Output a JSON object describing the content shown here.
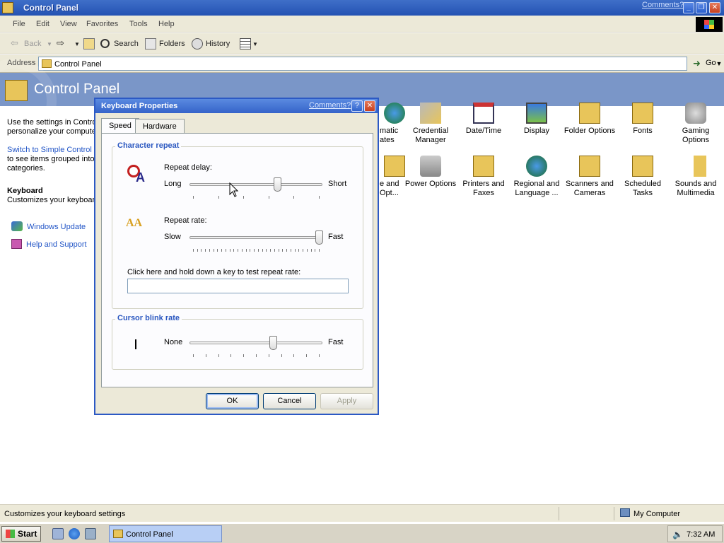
{
  "window": {
    "title": "Control Panel",
    "comments_link": "Comments?"
  },
  "menu": [
    "File",
    "Edit",
    "View",
    "Favorites",
    "Tools",
    "Help"
  ],
  "toolbar": {
    "back": "Back",
    "search": "Search",
    "folders": "Folders",
    "history": "History"
  },
  "address": {
    "label": "Address",
    "value": "Control Panel",
    "go": "Go"
  },
  "banner": {
    "title": "Control Panel"
  },
  "left_pane": {
    "intro_line1": "Use the settings in Contro",
    "intro_line2": "personalize your compute",
    "switch_line1": "Switch to Simple Control P",
    "switch_line2": "to see items grouped into",
    "switch_line3": "categories.",
    "item_title": "Keyboard",
    "item_desc": "Customizes your keyboar",
    "link_update": "Windows Update",
    "link_help": "Help and Support"
  },
  "icons_row1": [
    {
      "line1": "matic",
      "line2": "ates"
    },
    {
      "line1": "Credential",
      "line2": "Manager"
    },
    {
      "line1": "Date/Time",
      "line2": ""
    },
    {
      "line1": "Display",
      "line2": ""
    },
    {
      "line1": "Folder Options",
      "line2": ""
    },
    {
      "line1": "Fonts",
      "line2": ""
    },
    {
      "line1": "Gaming",
      "line2": "Options"
    }
  ],
  "icons_row2": [
    {
      "line1": "e and",
      "line2": "Opt..."
    },
    {
      "line1": "Power Options",
      "line2": ""
    },
    {
      "line1": "Printers and",
      "line2": "Faxes"
    },
    {
      "line1": "Regional and",
      "line2": "Language ..."
    },
    {
      "line1": "Scanners and",
      "line2": "Cameras"
    },
    {
      "line1": "Scheduled",
      "line2": "Tasks"
    },
    {
      "line1": "Sounds and",
      "line2": "Multimedia"
    }
  ],
  "dialog": {
    "title": "Keyboard Properties",
    "comments": "Comments?",
    "tabs": [
      "Speed",
      "Hardware"
    ],
    "group_repeat": "Character repeat",
    "repeat_delay_label": "Repeat delay:",
    "repeat_delay_min": "Long",
    "repeat_delay_max": "Short",
    "repeat_delay_value": 0.67,
    "repeat_rate_label": "Repeat rate:",
    "repeat_rate_min": "Slow",
    "repeat_rate_max": "Fast",
    "repeat_rate_value": 1.0,
    "test_label": "Click here and hold down a key to test repeat rate:",
    "test_value": "",
    "group_cursor": "Cursor blink rate",
    "cursor_min": "None",
    "cursor_max": "Fast",
    "cursor_value": 0.64,
    "ok": "OK",
    "cancel": "Cancel",
    "apply": "Apply"
  },
  "statusbar": {
    "text": "Customizes your keyboard settings",
    "zone": "My Computer"
  },
  "taskbar": {
    "start": "Start",
    "task": "Control Panel",
    "clock": "7:32 AM"
  }
}
